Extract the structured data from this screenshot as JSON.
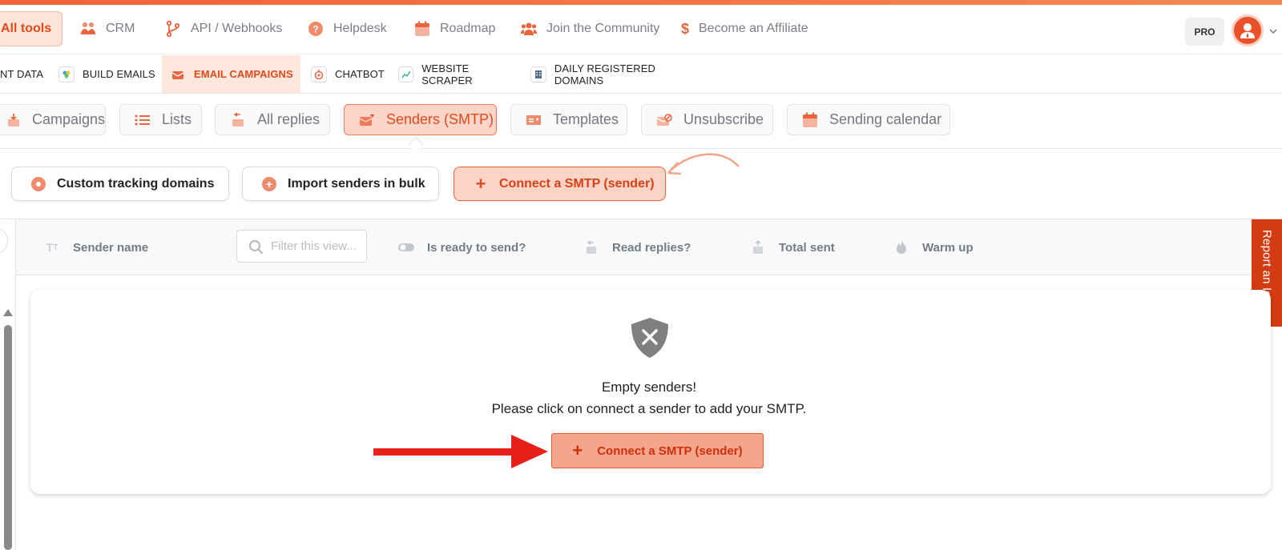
{
  "nav_top": {
    "items": [
      {
        "label": "All tools",
        "icon": "grid-icon"
      },
      {
        "label": "CRM",
        "icon": "handshake-icon"
      },
      {
        "label": "API / Webhooks",
        "icon": "branch-icon"
      },
      {
        "label": "Helpdesk",
        "icon": "question-icon"
      },
      {
        "label": "Roadmap",
        "icon": "calendar-icon"
      },
      {
        "label": "Join the Community",
        "icon": "users-icon"
      },
      {
        "label": "Become an Affiliate",
        "icon": "dollar-icon"
      }
    ],
    "pro_badge": "PRO"
  },
  "tool_tabs": [
    {
      "label": "NT DATA"
    },
    {
      "label": "BUILD EMAILS"
    },
    {
      "label": "EMAIL CAMPAIGNS"
    },
    {
      "label": "CHATBOT"
    },
    {
      "label": "WEBSITE SCRAPER"
    },
    {
      "label": "DAILY REGISTERED DOMAINS"
    }
  ],
  "sub_tabs": [
    {
      "label": "Campaigns"
    },
    {
      "label": "Lists"
    },
    {
      "label": "All replies"
    },
    {
      "label": "Senders (SMTP)"
    },
    {
      "label": "Templates"
    },
    {
      "label": "Unsubscribe"
    },
    {
      "label": "Sending calendar"
    }
  ],
  "actions": {
    "tracking": "Custom tracking domains",
    "import": "Import senders in bulk",
    "connect": "Connect a SMTP (sender)"
  },
  "columns": {
    "sender_name": "Sender name",
    "filter_placeholder": "Filter this view...",
    "ready": "Is ready to send?",
    "replies": "Read replies?",
    "total": "Total sent",
    "warmup": "Warm up"
  },
  "report_issue": "Report an Issue",
  "empty": {
    "title": "Empty senders!",
    "subtitle": "Please click on connect a sender to add your SMTP.",
    "button": "Connect a SMTP (sender)"
  },
  "colors": {
    "accent": "#e9512a",
    "accent_light": "#fcd4c6",
    "annotation_arrow": "#e8201c"
  }
}
